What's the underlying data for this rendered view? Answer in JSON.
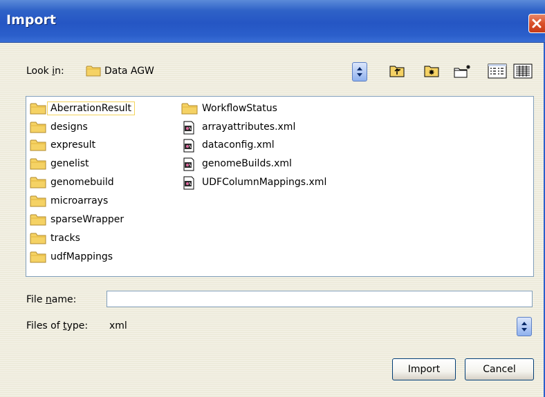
{
  "window": {
    "title": "Import"
  },
  "look_in": {
    "label_prefix": "Look ",
    "label_access_key": "i",
    "label_suffix": "n:",
    "value": "Data AGW"
  },
  "toolbar": {
    "buttons": [
      {
        "name": "up-one-level-icon"
      },
      {
        "name": "desktop-icon"
      },
      {
        "name": "create-new-folder-icon"
      },
      {
        "name": "list-view-icon"
      },
      {
        "name": "details-view-icon"
      }
    ]
  },
  "files": {
    "column1": [
      {
        "name": "AberrationResult",
        "type": "folder",
        "focused": true
      },
      {
        "name": "designs",
        "type": "folder"
      },
      {
        "name": "expresult",
        "type": "folder"
      },
      {
        "name": "genelist",
        "type": "folder"
      },
      {
        "name": "genomebuild",
        "type": "folder"
      },
      {
        "name": "microarrays",
        "type": "folder"
      },
      {
        "name": "sparseWrapper",
        "type": "folder"
      },
      {
        "name": "tracks",
        "type": "folder"
      },
      {
        "name": "udfMappings",
        "type": "folder"
      }
    ],
    "column2": [
      {
        "name": "WorkflowStatus",
        "type": "folder"
      },
      {
        "name": "arrayattributes.xml",
        "type": "xml"
      },
      {
        "name": "dataconfig.xml",
        "type": "xml"
      },
      {
        "name": "genomeBuilds.xml",
        "type": "xml"
      },
      {
        "name": "UDFColumnMappings.xml",
        "type": "xml"
      }
    ]
  },
  "file_name": {
    "label_prefix": "File ",
    "label_access_key": "n",
    "label_suffix": "ame:",
    "value": "",
    "placeholder": ""
  },
  "files_of_type": {
    "label_prefix": "Files of ",
    "label_access_key": "t",
    "label_suffix": "ype:",
    "value": "xml"
  },
  "buttons": {
    "import": "Import",
    "cancel": "Cancel"
  },
  "colors": {
    "title_bar": "#2556c4",
    "close_button": "#d9502b",
    "dialog_bg": "#ece9d8",
    "folder": "#f5d264"
  }
}
